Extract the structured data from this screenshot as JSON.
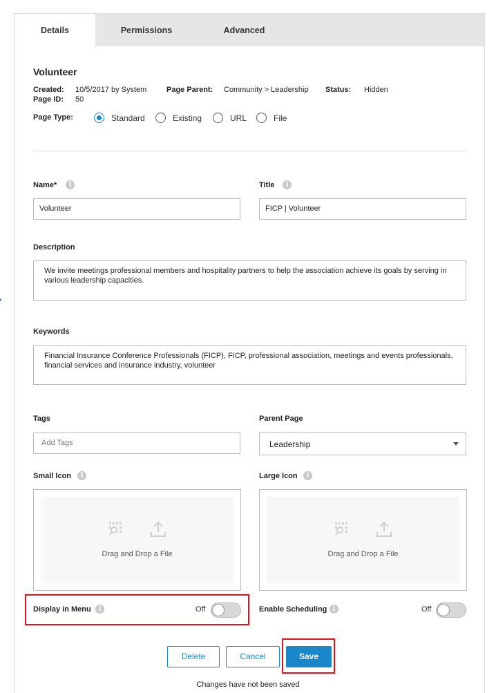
{
  "tabs": [
    {
      "label": "Details"
    },
    {
      "label": "Permissions"
    },
    {
      "label": "Advanced"
    }
  ],
  "page": {
    "title": "Volunteer",
    "created_label": "Created:",
    "created_value": "10/5/2017 by System",
    "page_id_label": "Page ID:",
    "page_id_value": "50",
    "page_parent_label": "Page Parent:",
    "page_parent_value": "Community > Leadership",
    "status_label": "Status:",
    "status_value": "Hidden"
  },
  "page_type": {
    "label": "Page Type:",
    "options": [
      "Standard",
      "Existing",
      "URL",
      "File"
    ],
    "selected": "Standard"
  },
  "form": {
    "name_label": "Name*",
    "name_value": "Volunteer",
    "title_label": "Title",
    "title_value": "FICP | Volunteer",
    "description_label": "Description",
    "description_value": "We invite meetings professional members and hospitality partners to help the association achieve its goals by serving in various leadership capacities.",
    "keywords_label": "Keywords",
    "keywords_value": "Financial Insurance Conference Professionals (FICP), FICP, professional association, meetings and events professionals, financial services and insurance industry, volunteer",
    "tags_label": "Tags",
    "tags_placeholder": "Add Tags",
    "parent_page_label": "Parent Page",
    "parent_page_value": "Leadership",
    "small_icon_label": "Small Icon",
    "large_icon_label": "Large Icon",
    "dropzone_text": "Drag and Drop a File",
    "display_in_menu_label": "Display in Menu",
    "display_in_menu_state": "Off",
    "enable_scheduling_label": "Enable Scheduling",
    "enable_scheduling_state": "Off"
  },
  "actions": {
    "delete_label": "Delete",
    "cancel_label": "Cancel",
    "save_label": "Save",
    "unsaved_message": "Changes have not been saved"
  },
  "colors": {
    "accent": "#1a87c9",
    "highlight": "#e0111a",
    "tab_bar": "#e6e6e6"
  },
  "icons": [
    "info-icon",
    "image-search-icon",
    "upload-icon",
    "select-arrow-icon"
  ]
}
